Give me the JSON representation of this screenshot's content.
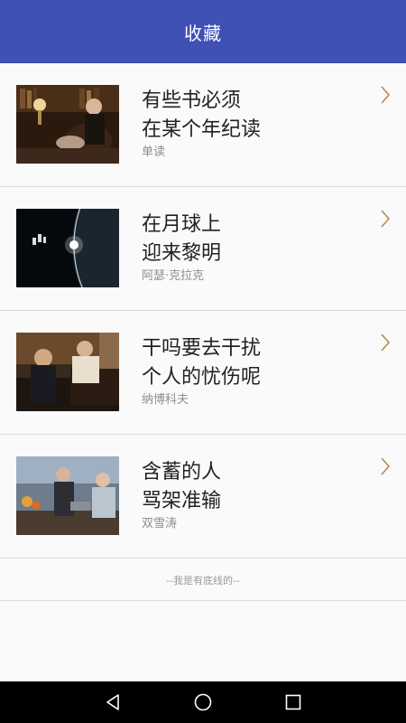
{
  "header": {
    "title": "收藏"
  },
  "items": [
    {
      "line1": "有些书必须",
      "line2": "在某个年纪读",
      "author": "单读",
      "image": "library-reader-with-cat"
    },
    {
      "line1": "在月球上",
      "line2": "迎来黎明",
      "author": "阿瑟·克拉克",
      "image": "space-astronaut-earth-horizon"
    },
    {
      "line1": "干吗要去干扰",
      "line2": "个人的忧伤呢",
      "author": "纳博科夫",
      "image": "couple-at-piano"
    },
    {
      "line1": "含蓄的人",
      "line2": "骂架准输",
      "author": "双雪涛",
      "image": "people-at-bar"
    }
  ],
  "footer": {
    "note": "--我是有底线的--"
  },
  "nav": {
    "back": "back-icon",
    "home": "home-icon",
    "recents": "recents-icon"
  },
  "colors": {
    "primary": "#3f51b5",
    "chevron": "#b8894a"
  }
}
